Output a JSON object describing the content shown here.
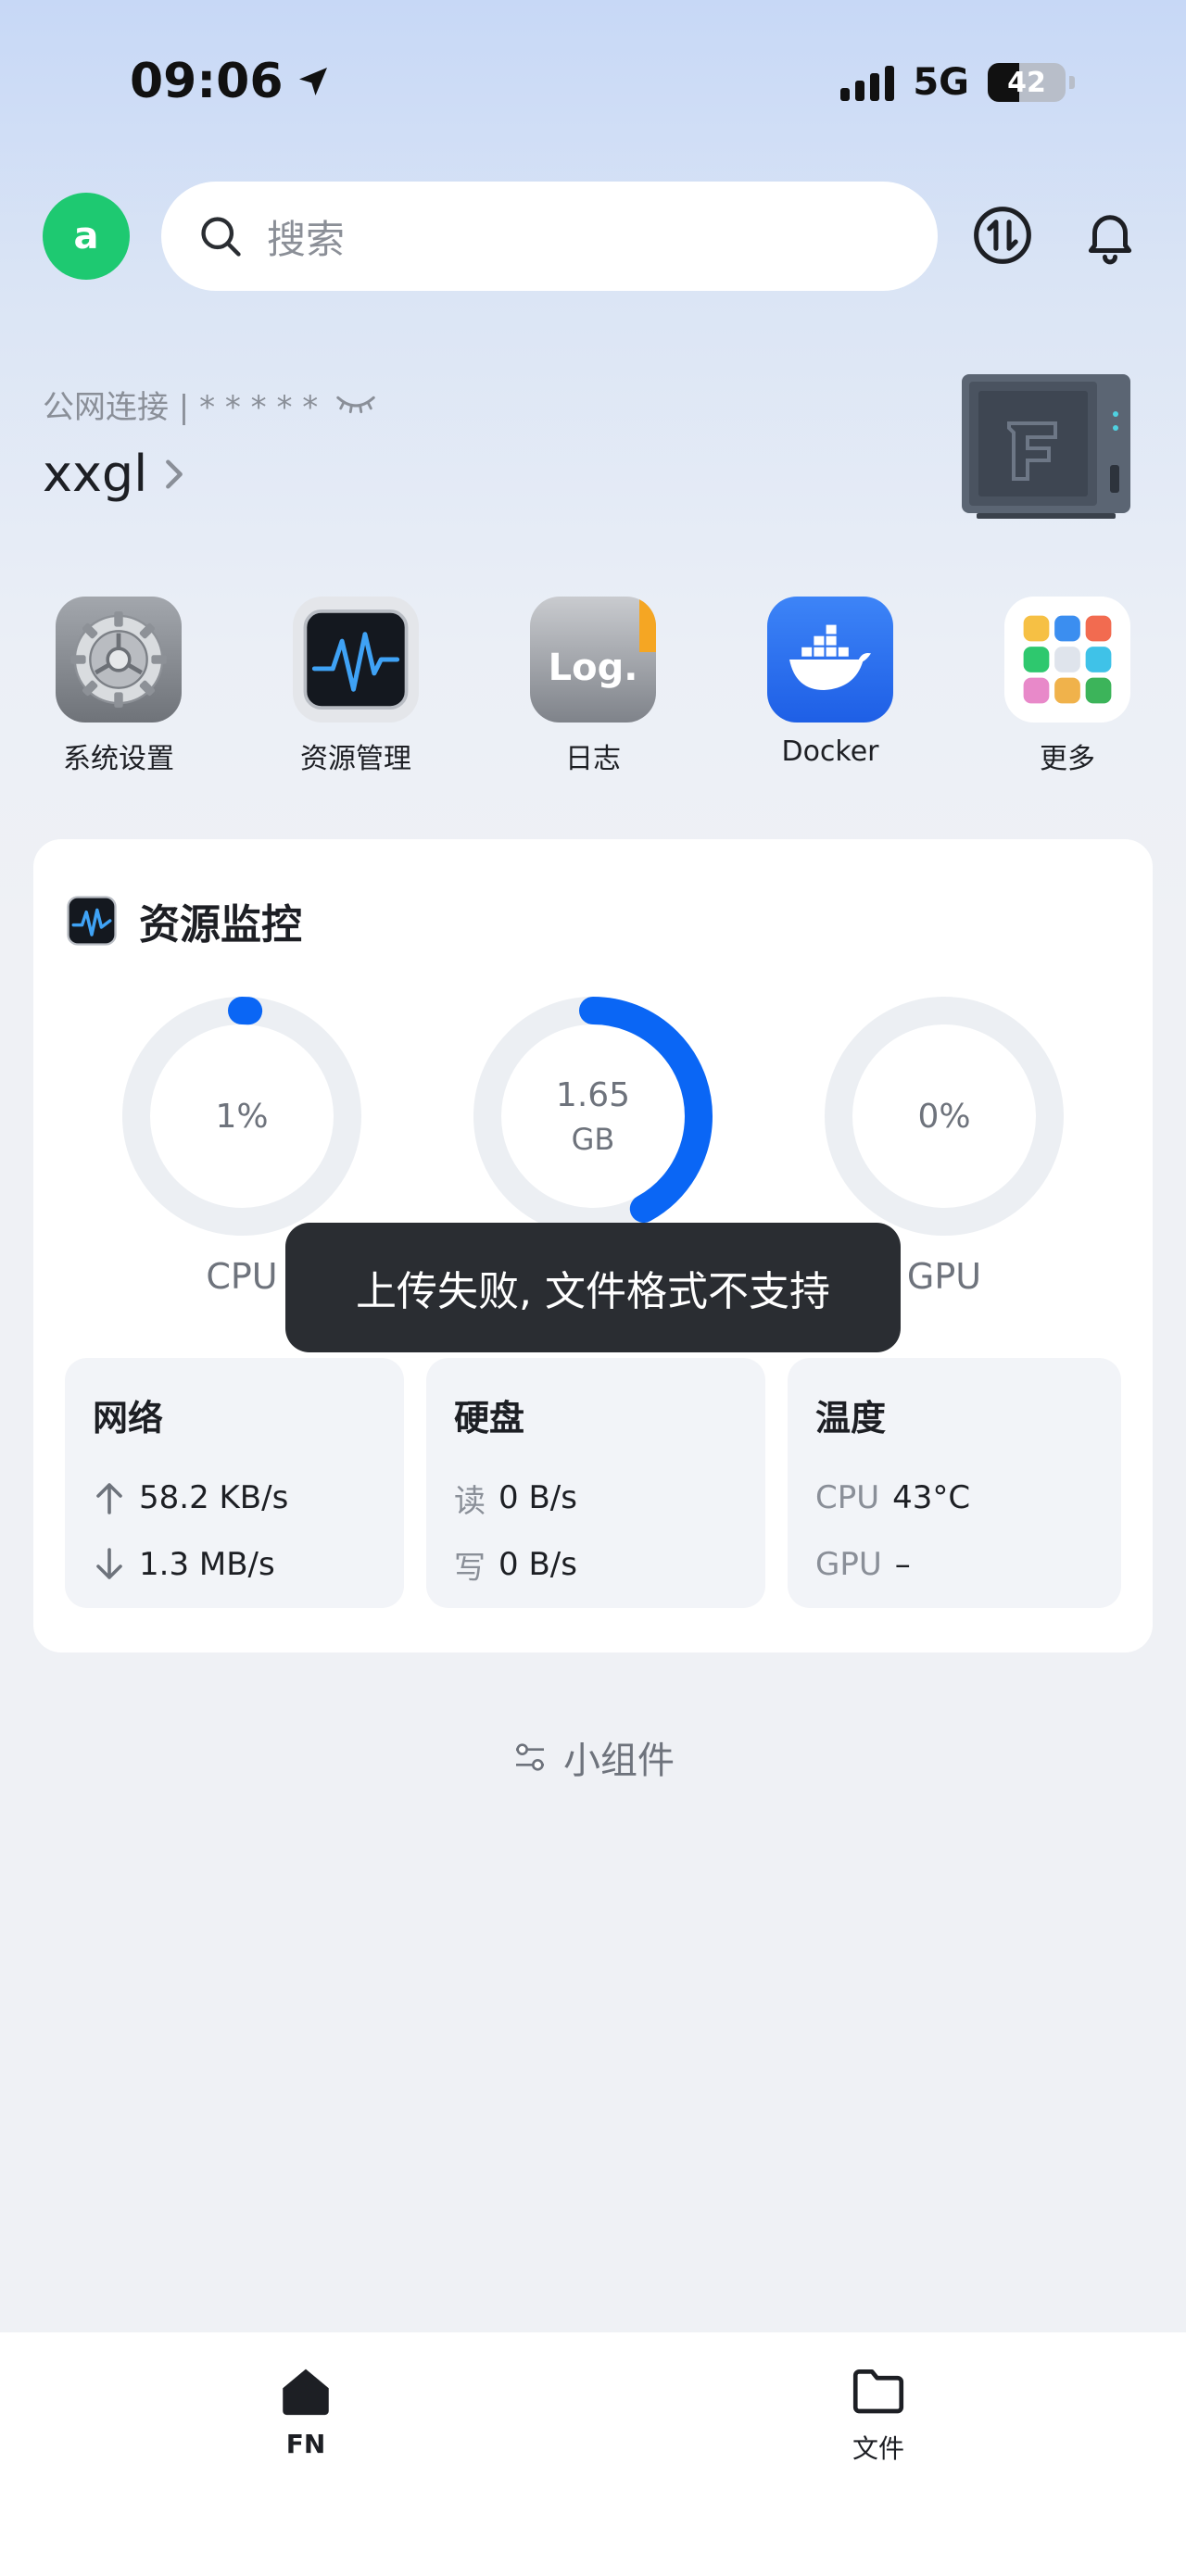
{
  "status_bar": {
    "time": "09:06",
    "network": "5G",
    "battery": "42"
  },
  "header": {
    "avatar_letter": "a",
    "search_placeholder": "搜索"
  },
  "server": {
    "connection": "公网连接 | * * * * *",
    "name": "xxgl"
  },
  "apps": [
    {
      "label": "系统设置",
      "icon": "gear-icon"
    },
    {
      "label": "资源管理",
      "icon": "activity-monitor-icon"
    },
    {
      "label": "日志",
      "icon": "log-icon"
    },
    {
      "label": "Docker",
      "icon": "docker-icon"
    },
    {
      "label": "更多",
      "icon": "grid-icon"
    }
  ],
  "monitor": {
    "title": "资源监控",
    "gauges": [
      {
        "label": "CPU",
        "value": "1%",
        "unit": "",
        "fraction": 0.01
      },
      {
        "label": "",
        "value": "1.65",
        "unit": "GB",
        "fraction": 0.42
      },
      {
        "label": "GPU",
        "value": "0%",
        "unit": "",
        "fraction": 0
      }
    ],
    "network": {
      "title": "网络",
      "up": "58.2 KB/s",
      "down": "1.3 MB/s"
    },
    "disk": {
      "title": "硬盘",
      "read_label": "读",
      "read": "0 B/s",
      "write_label": "写",
      "write": "0 B/s"
    },
    "temp": {
      "title": "温度",
      "cpu_label": "CPU",
      "cpu": "43°C",
      "gpu_label": "GPU",
      "gpu": "–"
    }
  },
  "widgets_label": "小组件",
  "toast": "上传失败, 文件格式不支持",
  "nav": [
    {
      "label": "FN",
      "icon": "home-icon",
      "active": true
    },
    {
      "label": "文件",
      "icon": "folder-icon",
      "active": false
    }
  ],
  "colors": {
    "accent": "#0a66f5",
    "avatar": "#1ec971",
    "track": "#eceff3"
  }
}
